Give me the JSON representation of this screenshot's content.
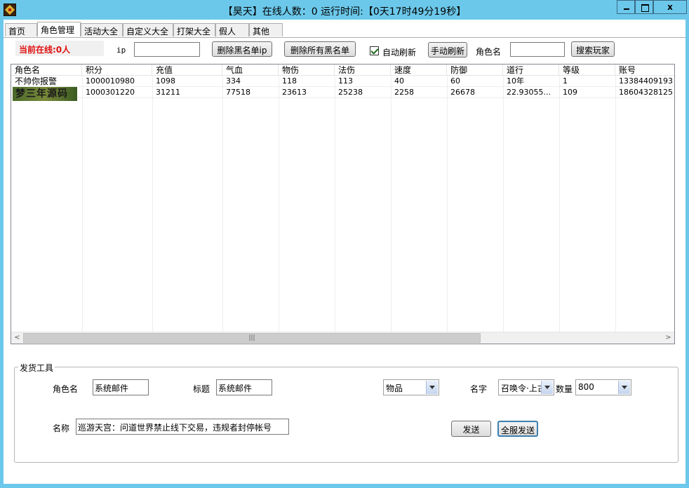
{
  "window": {
    "title": "【昊天】在线人数：0  运行时间:【0天17时49分19秒】",
    "close_glyph": "x"
  },
  "tabs": [
    "首页",
    "角色管理",
    "活动大全",
    "自定义大全",
    "打架大全",
    "假人",
    "其他"
  ],
  "toolbar": {
    "online_label": "当前在线:0人",
    "ip_label": "ip",
    "ip_value": "",
    "delete_blacklist_ip": "删除黑名单ip",
    "delete_all_blacklist": "删除所有黑名单",
    "auto_refresh_label": "自动刷新",
    "auto_refresh_checked": true,
    "manual_refresh": "手动刷新",
    "role_name_label": "角色名",
    "role_name_value": "",
    "search_player": "搜索玩家"
  },
  "table": {
    "columns": [
      "角色名",
      "积分",
      "充值",
      "气血",
      "物伤",
      "法伤",
      "速度",
      "防御",
      "道行",
      "等级",
      "账号"
    ],
    "rows": [
      [
        "不帅你报警",
        "1000010980",
        "1098",
        "334",
        "118",
        "113",
        "40",
        "60",
        "10年",
        "1",
        "13384409193"
      ],
      [
        "",
        "1000301220",
        "31211",
        "77518",
        "23613",
        "25238",
        "2258",
        "26678",
        "22.93055...",
        "109",
        "18604328125"
      ]
    ],
    "watermark": "梦三年源码"
  },
  "delivery": {
    "group_title": "发货工具",
    "role_name_label": "角色名",
    "role_name_value": "系统邮件",
    "subject_label": "标题",
    "subject_value": "系统邮件",
    "type_select": "物品",
    "item_name_label": "名字",
    "item_name_select": "召唤令·上古",
    "quantity_label": "数量",
    "quantity_select": "800",
    "message_label": "名称",
    "message_value": "巡游天宫：问道世界禁止线下交易，违规者封停帐号",
    "send_button": "发送",
    "send_all_button": "全服发送"
  }
}
